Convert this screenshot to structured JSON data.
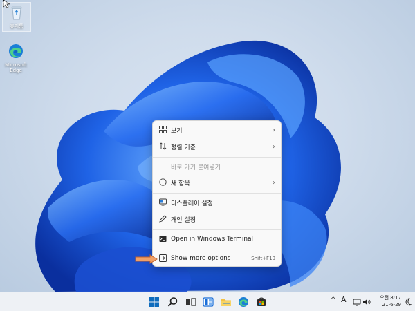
{
  "desktop": {
    "icons": [
      {
        "label": "휴지통",
        "icon": "recycle-bin-icon"
      },
      {
        "label": "Microsoft Edge",
        "icon": "edge-icon"
      }
    ]
  },
  "context_menu": {
    "items": [
      {
        "label": "보기",
        "icon": "grid-icon",
        "submenu": true
      },
      {
        "label": "정렬 기준",
        "icon": "sort-icon",
        "submenu": true
      },
      {
        "label": "바로 가기 붙여넣기",
        "disabled": true
      },
      {
        "label": "새 항목",
        "icon": "plus-circle-icon",
        "submenu": true
      },
      {
        "label": "디스플레이 설정",
        "icon": "display-icon"
      },
      {
        "label": "개인 설정",
        "icon": "pen-icon"
      },
      {
        "label": "Open in Windows Terminal",
        "icon": "terminal-icon"
      },
      {
        "label": "Show more options",
        "icon": "more-options-icon",
        "shortcut": "Shift+F10"
      }
    ]
  },
  "taskbar": {
    "apps": [
      "start-icon",
      "search-icon",
      "task-view-icon",
      "widgets-icon",
      "file-explorer-icon",
      "edge-icon",
      "store-icon"
    ],
    "tray": {
      "chevron": "^",
      "input_indicator": "A",
      "clock_period": "오전",
      "clock_time": "8:17",
      "date": "21-6-29"
    }
  },
  "colors": {
    "accent": "#0f6cbd",
    "wallpaper_bloom": "#1e5fe0",
    "arrow": "#e07a3a"
  }
}
